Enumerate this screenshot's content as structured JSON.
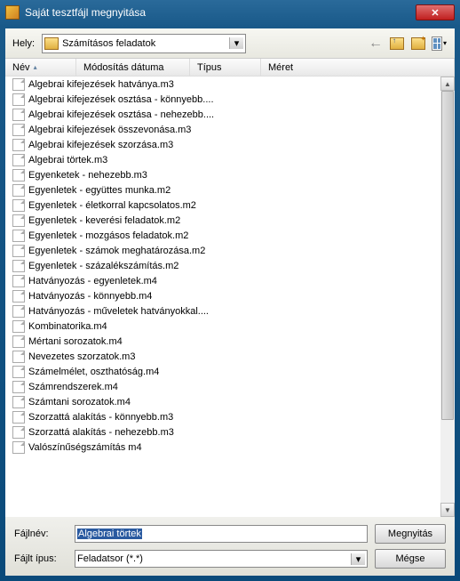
{
  "window": {
    "title": "Saját tesztfájl megnyitása"
  },
  "toolbar": {
    "location_label": "Hely:",
    "path": "Számításos feladatok"
  },
  "columns": {
    "name": "Név",
    "date": "Módosítás dátuma",
    "type": "Típus",
    "size": "Méret"
  },
  "files": [
    "Algebrai kifejezések hatványa.m3",
    "Algebrai kifejezések osztása - könnyebb....",
    "Algebrai kifejezések osztása - nehezebb....",
    "Algebrai kifejezések összevonása.m3",
    "Algebrai kifejezések szorzása.m3",
    "Algebrai törtek.m3",
    "Egyenketek - nehezebb.m3",
    "Egyenletek - együttes munka.m2",
    "Egyenletek - életkorral kapcsolatos.m2",
    "Egyenletek - keverési feladatok.m2",
    "Egyenletek - mozgásos feladatok.m2",
    "Egyenletek - számok meghatározása.m2",
    "Egyenletek - százalékszámítás.m2",
    "Hatványozás - egyenletek.m4",
    "Hatványozás - könnyebb.m4",
    "Hatványozás - műveletek hatványokkal....",
    "Kombinatorika.m4",
    "Mértani sorozatok.m4",
    "Nevezetes szorzatok.m3",
    "Számelmélet, oszthatóság.m4",
    "Számrendszerek.m4",
    "Számtani sorozatok.m4",
    "Szorzattá alakítás - könnyebb.m3",
    "Szorzattá alakítás - nehezebb.m3",
    "Valószínűségszámítás m4"
  ],
  "bottom": {
    "filename_label": "Fájlnév:",
    "filename_value": "Algebrai törtek",
    "filetype_label": "Fájlt ípus:",
    "filetype_value": "Feladatsor (*.*)",
    "open": "Megnyitás",
    "cancel": "Mégse"
  }
}
